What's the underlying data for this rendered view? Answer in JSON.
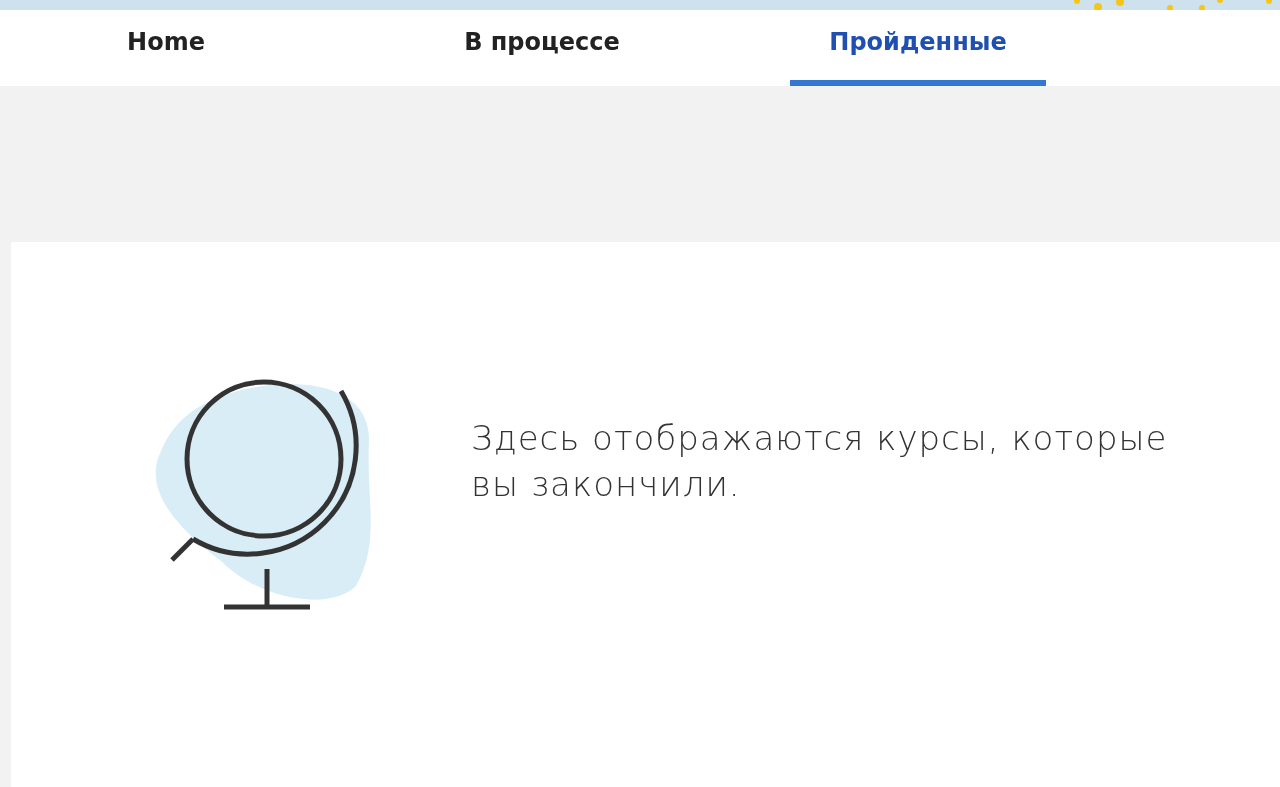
{
  "tabs": [
    {
      "label": "Home",
      "selected": false
    },
    {
      "label": "В процессе",
      "selected": false
    },
    {
      "label": "Пройденные",
      "selected": true
    }
  ],
  "empty_state": {
    "message": "Здесь отображаются курсы, которые вы закончили."
  }
}
